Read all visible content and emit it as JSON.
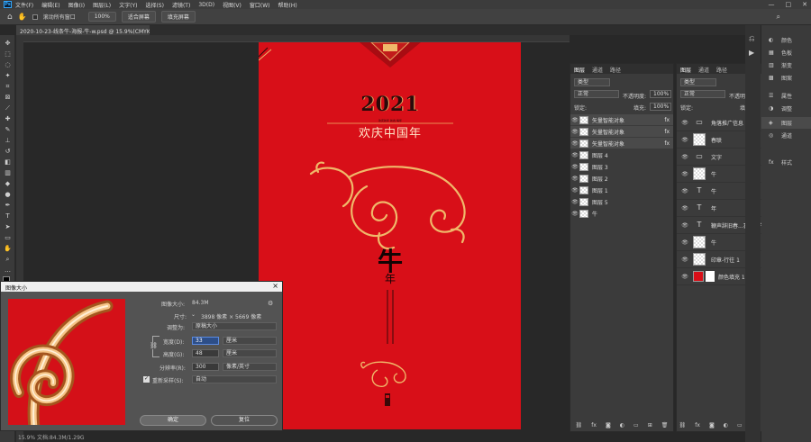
{
  "menu": {
    "items": [
      "文件(F)",
      "编辑(E)",
      "图像(I)",
      "图层(L)",
      "文字(Y)",
      "选择(S)",
      "滤镜(T)",
      "3D(D)",
      "视图(V)",
      "窗口(W)",
      "帮助(H)"
    ],
    "ps_logo": "Ps"
  },
  "options": {
    "scroll_all": "滚动所有窗口",
    "zoom": "100%",
    "fit_screen": "适合屏幕",
    "fill_screen": "填充屏幕"
  },
  "document": {
    "tab_title": "2020-10-23-线条牛-海报-牛-w.psd @ 15.9%(CMYK/8)",
    "bottom_status": "15.9%  文档:84.3M/1.29G"
  },
  "poster": {
    "year": "2021",
    "small_text": "欢庆新年 新春 每年",
    "title": "欢庆中国年",
    "red_sub": "CHINESE NEW YEAR",
    "big_char": "牛",
    "small_char": "年",
    "colors": {
      "bg": "#d80f18",
      "gold": "#f0b86a",
      "dark": "#2a0a0a"
    }
  },
  "dialog": {
    "title": "图像大小",
    "close": "×",
    "image_size_label": "图像大小:",
    "image_size_value": "84.3M",
    "dimensions_label": "尺寸:",
    "dimensions_value": "3898 像素 × 5669 像素",
    "fit_label": "调整为:",
    "fit_value": "原稿大小",
    "width_label": "宽度(D):",
    "width_value": "33",
    "width_unit": "厘米",
    "height_label": "高度(G):",
    "height_value": "48",
    "height_unit": "厘米",
    "res_label": "分辨率(R):",
    "res_value": "300",
    "res_unit": "像素/英寸",
    "resample_label": "重新采样(S):",
    "resample_value": "自动",
    "ok": "确定",
    "reset": "复位"
  },
  "layers_left": {
    "tabs": [
      "图层",
      "通道",
      "路径"
    ],
    "kind": "类型",
    "blend": "正常",
    "opacity_label": "不透明度:",
    "opacity": "100%",
    "lock_label": "锁定:",
    "fill_label": "填充:",
    "fill": "100%",
    "rows": [
      {
        "name": "矢量智能对象",
        "fx": "fx"
      },
      {
        "name": "矢量智能对象",
        "fx": "fx"
      },
      {
        "name": "矢量智能对象",
        "fx": "fx"
      },
      {
        "name": "图层 4",
        "fx": ""
      },
      {
        "name": "图层 3",
        "fx": ""
      },
      {
        "name": "图层 2",
        "fx": ""
      },
      {
        "name": "图层 1",
        "fx": ""
      },
      {
        "name": "图层 5",
        "fx": ""
      },
      {
        "name": "牛",
        "fx": ""
      }
    ]
  },
  "layers_right": {
    "tabs": [
      "图层",
      "通道",
      "路径"
    ],
    "kind": "类型",
    "blend": "正常",
    "opacity_label": "不透明度:",
    "opacity": "100%",
    "lock_label": "锁定:",
    "fill_label": "填充:",
    "fill": "100%",
    "rows": [
      {
        "name": "角落推广信息",
        "icon": "folder"
      },
      {
        "name": "春联",
        "icon": "thumb"
      },
      {
        "name": "文字",
        "icon": "folder"
      },
      {
        "name": "牛",
        "icon": "thumb"
      },
      {
        "name": "牛",
        "icon": "T"
      },
      {
        "name": "年",
        "icon": "T"
      },
      {
        "name": "鞭声辞旧春...喜入丑牛",
        "icon": "T"
      },
      {
        "name": "牛",
        "icon": "thumb"
      },
      {
        "name": "印章-行往 1",
        "icon": "thumb"
      },
      {
        "name": "颜色填充 1",
        "icon": "fill"
      }
    ]
  },
  "right_strip": {
    "items": [
      "颜色",
      "色板",
      "渐变",
      "图案",
      "属性",
      "调整",
      "图层",
      "通道",
      "样式"
    ]
  }
}
